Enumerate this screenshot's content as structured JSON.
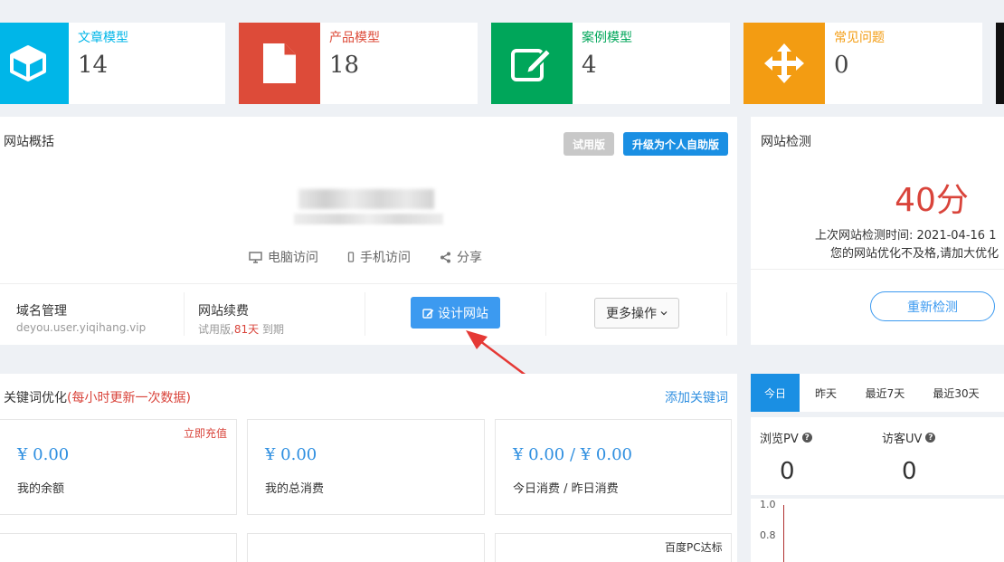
{
  "stats": [
    {
      "title": "文章模型",
      "value": "14",
      "color": "#00b6e8",
      "icon": "cube-icon"
    },
    {
      "title": "产品模型",
      "value": "18",
      "color": "#dd4b39",
      "icon": "file-icon"
    },
    {
      "title": "案例模型",
      "value": "4",
      "color": "#00a65a",
      "icon": "edit-icon"
    },
    {
      "title": "常见问题",
      "value": "0",
      "color": "#f39c12",
      "icon": "move-icon"
    }
  ],
  "overview": {
    "title": "网站概括",
    "trial_label": "试用版",
    "upgrade_label": "升级为个人自助版",
    "pc_visit": "电脑访问",
    "mobile_visit": "手机访问",
    "share": "分享",
    "domain_label": "域名管理",
    "domain_value": "deyou.user.yiqihang.vip",
    "renew_label": "网站续费",
    "renew_prefix": "试用版,",
    "renew_days": "81天",
    "renew_suffix": "到期",
    "design_label": "设计网站",
    "more_label": "更多操作"
  },
  "site_check": {
    "title": "网站检测",
    "score": "40分",
    "last_check": "上次网站检测时间: 2021-04-16 1",
    "advice": "您的网站优化不及格,请加大优化",
    "recheck_label": "重新检测"
  },
  "keywords": {
    "title": "关键词优化",
    "note": "(每小时更新一次数据)",
    "add_label": "添加关键词",
    "recharge_label": "立即充值",
    "balance_value": "¥ 0.00",
    "balance_label": "我的余额",
    "total_value": "¥ 0.00",
    "total_label": "我的总消费",
    "daily_value": "¥ 0.00 / ¥ 0.00",
    "daily_label": "今日消费 / 昨日消费",
    "baidu_label": "百度PC达标"
  },
  "traffic": {
    "tabs": [
      "今日",
      "昨天",
      "最近7天",
      "最近30天"
    ],
    "pv_label": "浏览PV",
    "pv_value": "0",
    "uv_label": "访客UV",
    "uv_value": "0",
    "axis": [
      "1.0",
      "0.8"
    ]
  }
}
